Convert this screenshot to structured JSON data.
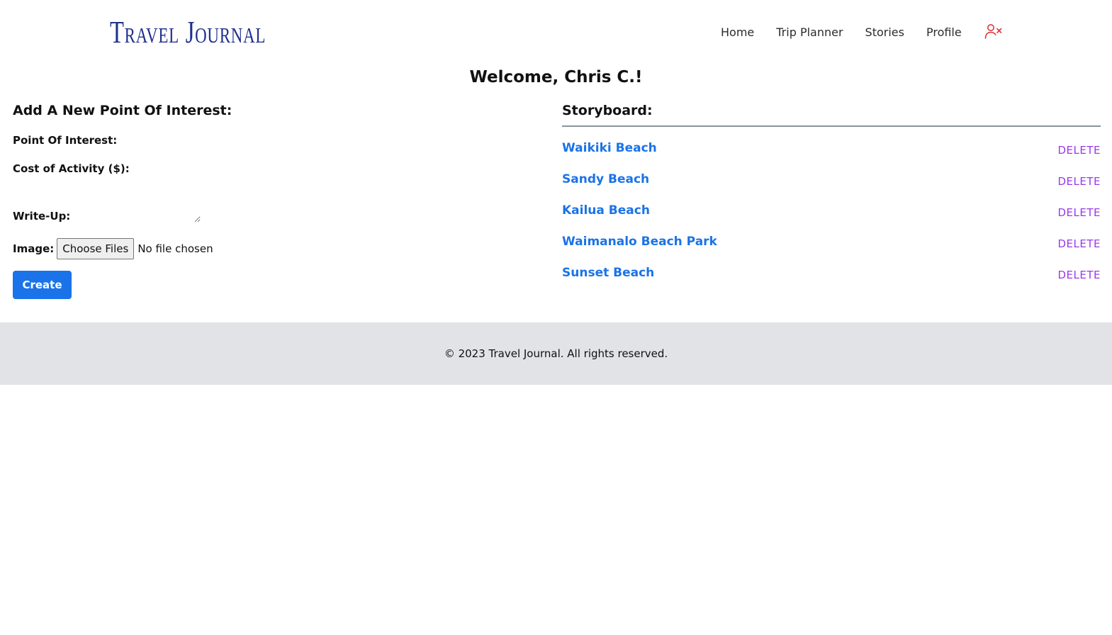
{
  "header": {
    "logo_text": "Travel Journal",
    "nav": [
      {
        "label": "Home"
      },
      {
        "label": "Trip Planner"
      },
      {
        "label": "Stories"
      },
      {
        "label": "Profile"
      }
    ],
    "logout_icon": "user-remove-icon",
    "logout_icon_color": "#e0383e"
  },
  "welcome": "Welcome, Chris C.!",
  "form": {
    "title": "Add A New Point Of Interest:",
    "poi_label": "Point Of Interest:",
    "poi_value": "",
    "cost_label": "Cost of Activity ($):",
    "cost_value": "",
    "writeup_label": "Write-Up:",
    "writeup_value": "",
    "image_label": "Image:",
    "file_button": "Choose Files",
    "file_status": "No file chosen",
    "create_button": "Create"
  },
  "storyboard": {
    "title": "Storyboard:",
    "delete_label": "DELETE",
    "items": [
      {
        "name": "Waikiki Beach"
      },
      {
        "name": "Sandy Beach"
      },
      {
        "name": "Kailua Beach"
      },
      {
        "name": "Waimanalo Beach Park"
      },
      {
        "name": "Sunset Beach"
      }
    ]
  },
  "footer": {
    "text": "© 2023 Travel Journal. All rights reserved."
  },
  "colors": {
    "accent_blue": "#1a73e8",
    "delete_purple": "#9b38e8",
    "logo_navy": "#1f2f8f",
    "footer_bg": "#e1e3e7"
  }
}
